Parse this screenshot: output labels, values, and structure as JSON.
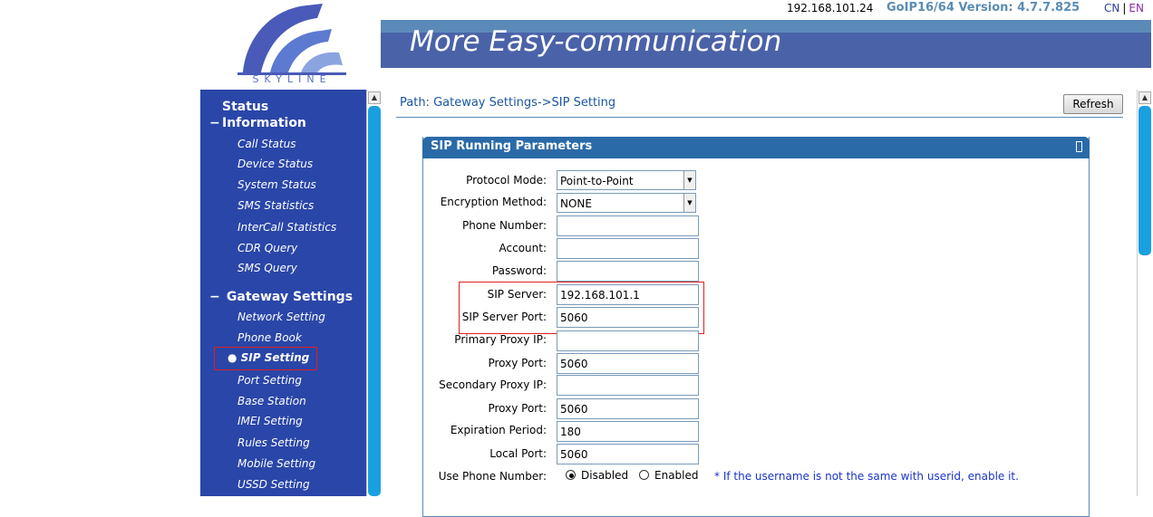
{
  "header": {
    "logo_text": "SKYLINE",
    "ip": "192.168.101.24",
    "version": "GoIP16/64 Version: 4.7.7.825",
    "lang_cn": "CN",
    "lang_sep": "|",
    "lang_en": "EN",
    "banner_title": "More Easy-communication"
  },
  "sidebar": {
    "status_section": "Status Information",
    "status_items": [
      "Call Status",
      "Device Status",
      "System Status",
      "SMS Statistics",
      "InterCall Statistics",
      "CDR Query",
      "SMS Query"
    ],
    "gateway_section": "Gateway Settings",
    "gateway_items": [
      "Network Setting",
      "Phone Book",
      "SIP Setting",
      "Port Setting",
      "Base Station",
      "IMEI Setting",
      "Rules Setting",
      "Mobile Setting",
      "USSD Setting"
    ],
    "active_item": "SIP Setting"
  },
  "main": {
    "path": "Path: Gateway Settings->SIP Setting",
    "refresh_label": "Refresh",
    "panel_title": "SIP Running Parameters",
    "fields": {
      "protocol_mode": {
        "label": "Protocol Mode:",
        "value": "Point-to-Point"
      },
      "encryption_method": {
        "label": "Encryption Method:",
        "value": "NONE"
      },
      "phone_number": {
        "label": "Phone Number:",
        "value": ""
      },
      "account": {
        "label": "Account:",
        "value": ""
      },
      "password": {
        "label": "Password:",
        "value": ""
      },
      "sip_server": {
        "label": "SIP Server:",
        "value": "192.168.101.1"
      },
      "sip_server_port": {
        "label": "SIP Server Port:",
        "value": "5060"
      },
      "primary_proxy_ip": {
        "label": "Primary Proxy IP:",
        "value": ""
      },
      "proxy_port_1": {
        "label": "Proxy Port:",
        "value": "5060"
      },
      "secondary_proxy_ip": {
        "label": "Secondary Proxy IP:",
        "value": ""
      },
      "proxy_port_2": {
        "label": "Proxy Port:",
        "value": "5060"
      },
      "expiration_period": {
        "label": "Expiration Period:",
        "value": "180"
      },
      "local_port": {
        "label": "Local Port:",
        "value": "5060"
      }
    },
    "use_phone_number": {
      "label": "Use Phone Number:",
      "disabled": "Disabled",
      "enabled": "Enabled",
      "selected": "Disabled",
      "note": "* If the username is not the same with userid, enable it."
    }
  }
}
